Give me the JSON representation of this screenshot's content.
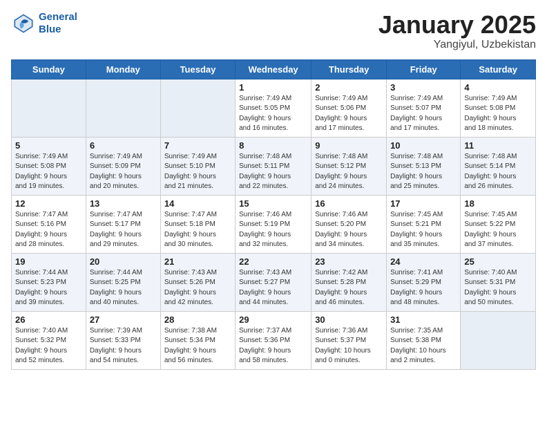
{
  "header": {
    "logo_line1": "General",
    "logo_line2": "Blue",
    "title": "January 2025",
    "subtitle": "Yangiyul, Uzbekistan"
  },
  "calendar": {
    "days_of_week": [
      "Sunday",
      "Monday",
      "Tuesday",
      "Wednesday",
      "Thursday",
      "Friday",
      "Saturday"
    ],
    "weeks": [
      [
        {
          "day": "",
          "detail": ""
        },
        {
          "day": "",
          "detail": ""
        },
        {
          "day": "",
          "detail": ""
        },
        {
          "day": "1",
          "detail": "Sunrise: 7:49 AM\nSunset: 5:05 PM\nDaylight: 9 hours\nand 16 minutes."
        },
        {
          "day": "2",
          "detail": "Sunrise: 7:49 AM\nSunset: 5:06 PM\nDaylight: 9 hours\nand 17 minutes."
        },
        {
          "day": "3",
          "detail": "Sunrise: 7:49 AM\nSunset: 5:07 PM\nDaylight: 9 hours\nand 17 minutes."
        },
        {
          "day": "4",
          "detail": "Sunrise: 7:49 AM\nSunset: 5:08 PM\nDaylight: 9 hours\nand 18 minutes."
        }
      ],
      [
        {
          "day": "5",
          "detail": "Sunrise: 7:49 AM\nSunset: 5:08 PM\nDaylight: 9 hours\nand 19 minutes."
        },
        {
          "day": "6",
          "detail": "Sunrise: 7:49 AM\nSunset: 5:09 PM\nDaylight: 9 hours\nand 20 minutes."
        },
        {
          "day": "7",
          "detail": "Sunrise: 7:49 AM\nSunset: 5:10 PM\nDaylight: 9 hours\nand 21 minutes."
        },
        {
          "day": "8",
          "detail": "Sunrise: 7:48 AM\nSunset: 5:11 PM\nDaylight: 9 hours\nand 22 minutes."
        },
        {
          "day": "9",
          "detail": "Sunrise: 7:48 AM\nSunset: 5:12 PM\nDaylight: 9 hours\nand 24 minutes."
        },
        {
          "day": "10",
          "detail": "Sunrise: 7:48 AM\nSunset: 5:13 PM\nDaylight: 9 hours\nand 25 minutes."
        },
        {
          "day": "11",
          "detail": "Sunrise: 7:48 AM\nSunset: 5:14 PM\nDaylight: 9 hours\nand 26 minutes."
        }
      ],
      [
        {
          "day": "12",
          "detail": "Sunrise: 7:47 AM\nSunset: 5:16 PM\nDaylight: 9 hours\nand 28 minutes."
        },
        {
          "day": "13",
          "detail": "Sunrise: 7:47 AM\nSunset: 5:17 PM\nDaylight: 9 hours\nand 29 minutes."
        },
        {
          "day": "14",
          "detail": "Sunrise: 7:47 AM\nSunset: 5:18 PM\nDaylight: 9 hours\nand 30 minutes."
        },
        {
          "day": "15",
          "detail": "Sunrise: 7:46 AM\nSunset: 5:19 PM\nDaylight: 9 hours\nand 32 minutes."
        },
        {
          "day": "16",
          "detail": "Sunrise: 7:46 AM\nSunset: 5:20 PM\nDaylight: 9 hours\nand 34 minutes."
        },
        {
          "day": "17",
          "detail": "Sunrise: 7:45 AM\nSunset: 5:21 PM\nDaylight: 9 hours\nand 35 minutes."
        },
        {
          "day": "18",
          "detail": "Sunrise: 7:45 AM\nSunset: 5:22 PM\nDaylight: 9 hours\nand 37 minutes."
        }
      ],
      [
        {
          "day": "19",
          "detail": "Sunrise: 7:44 AM\nSunset: 5:23 PM\nDaylight: 9 hours\nand 39 minutes."
        },
        {
          "day": "20",
          "detail": "Sunrise: 7:44 AM\nSunset: 5:25 PM\nDaylight: 9 hours\nand 40 minutes."
        },
        {
          "day": "21",
          "detail": "Sunrise: 7:43 AM\nSunset: 5:26 PM\nDaylight: 9 hours\nand 42 minutes."
        },
        {
          "day": "22",
          "detail": "Sunrise: 7:43 AM\nSunset: 5:27 PM\nDaylight: 9 hours\nand 44 minutes."
        },
        {
          "day": "23",
          "detail": "Sunrise: 7:42 AM\nSunset: 5:28 PM\nDaylight: 9 hours\nand 46 minutes."
        },
        {
          "day": "24",
          "detail": "Sunrise: 7:41 AM\nSunset: 5:29 PM\nDaylight: 9 hours\nand 48 minutes."
        },
        {
          "day": "25",
          "detail": "Sunrise: 7:40 AM\nSunset: 5:31 PM\nDaylight: 9 hours\nand 50 minutes."
        }
      ],
      [
        {
          "day": "26",
          "detail": "Sunrise: 7:40 AM\nSunset: 5:32 PM\nDaylight: 9 hours\nand 52 minutes."
        },
        {
          "day": "27",
          "detail": "Sunrise: 7:39 AM\nSunset: 5:33 PM\nDaylight: 9 hours\nand 54 minutes."
        },
        {
          "day": "28",
          "detail": "Sunrise: 7:38 AM\nSunset: 5:34 PM\nDaylight: 9 hours\nand 56 minutes."
        },
        {
          "day": "29",
          "detail": "Sunrise: 7:37 AM\nSunset: 5:36 PM\nDaylight: 9 hours\nand 58 minutes."
        },
        {
          "day": "30",
          "detail": "Sunrise: 7:36 AM\nSunset: 5:37 PM\nDaylight: 10 hours\nand 0 minutes."
        },
        {
          "day": "31",
          "detail": "Sunrise: 7:35 AM\nSunset: 5:38 PM\nDaylight: 10 hours\nand 2 minutes."
        },
        {
          "day": "",
          "detail": ""
        }
      ]
    ]
  }
}
